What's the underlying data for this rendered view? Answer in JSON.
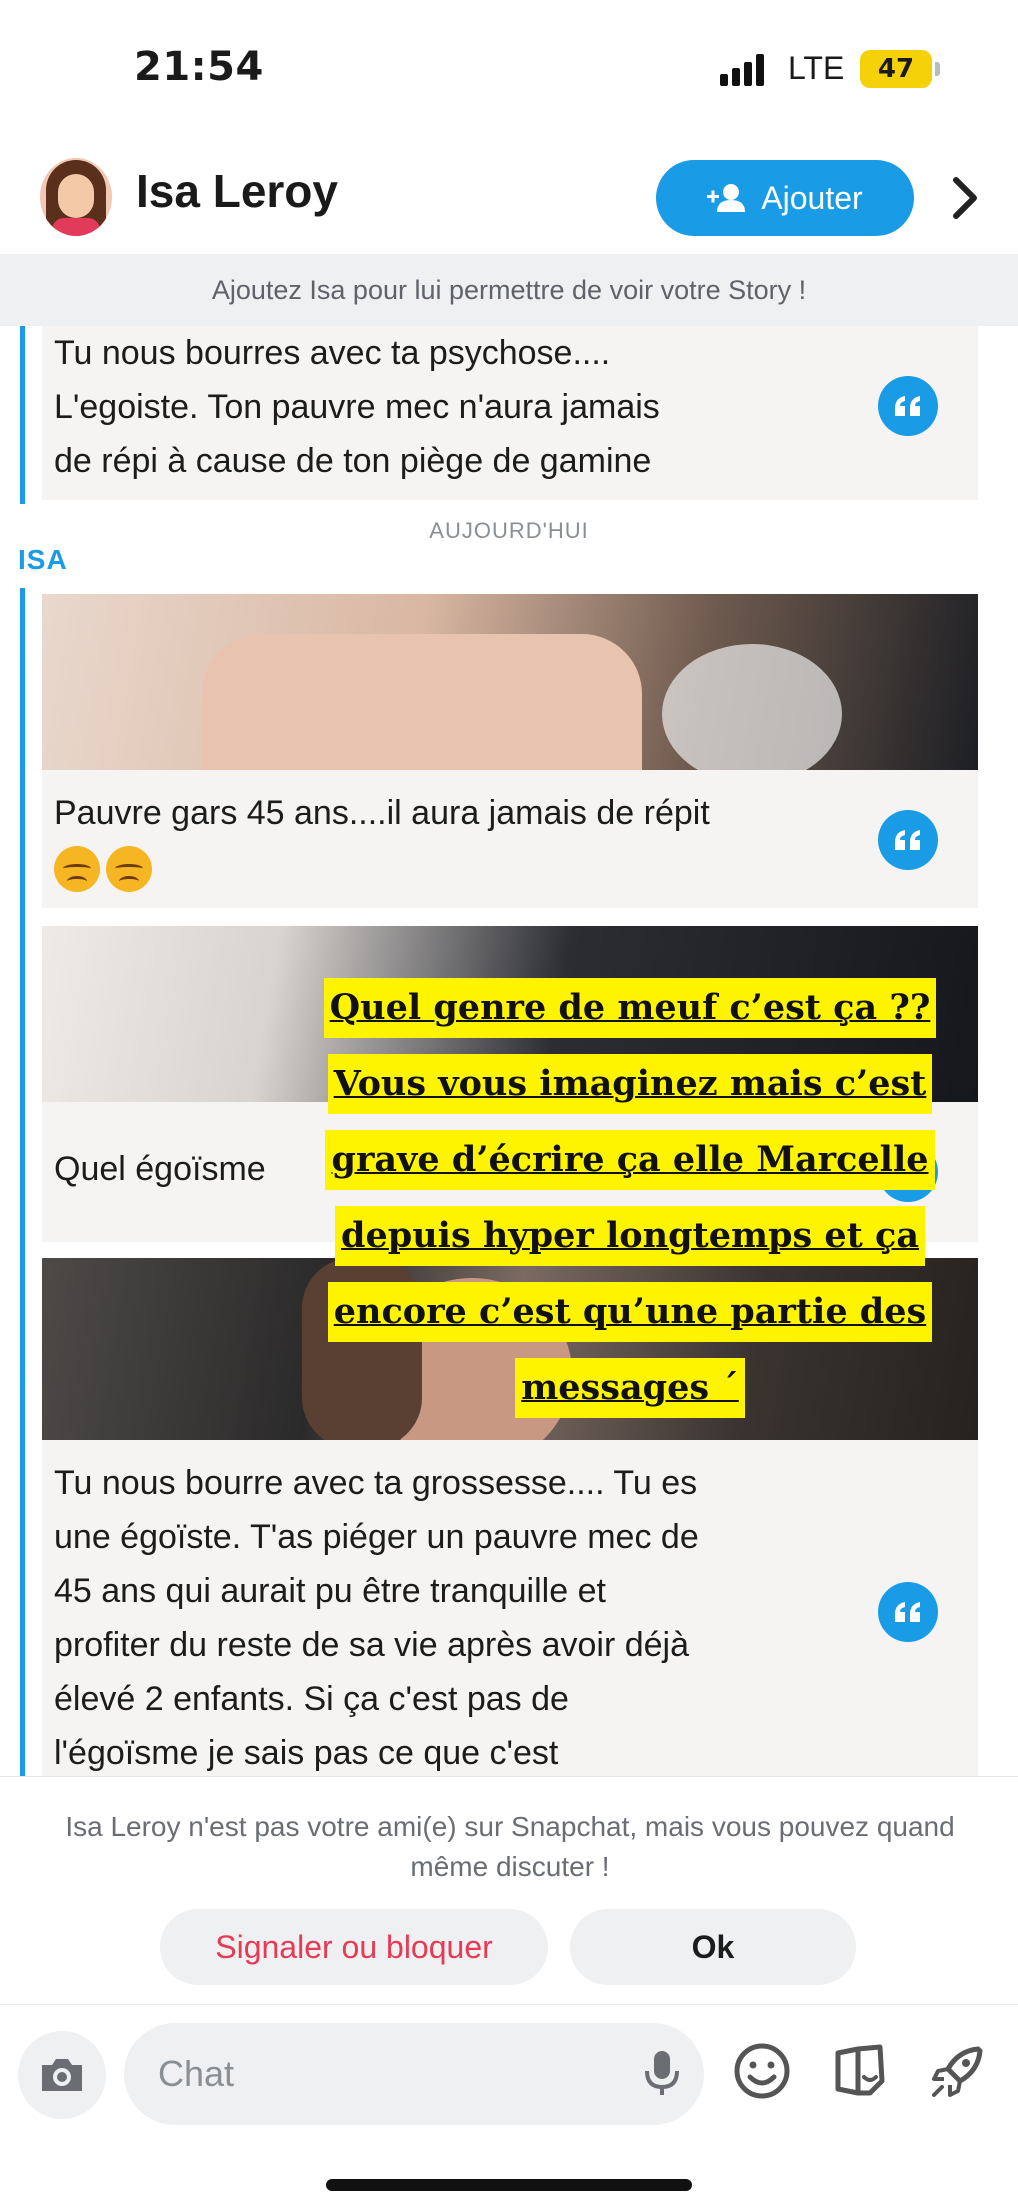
{
  "status_bar": {
    "time": "21:54",
    "network": "LTE",
    "battery": "47"
  },
  "header": {
    "title": "Isa Leroy",
    "add_label": "Ajouter"
  },
  "banner": {
    "text": "Ajoutez Isa pour lui permettre de voir votre Story !"
  },
  "chat": {
    "earlier_message": {
      "lines": [
        "Tu nous bourres avec ta psychose....",
        "L'egoiste. Ton pauvre mec  n'aura jamais",
        "de répi à cause de ton piège de gamine"
      ]
    },
    "day_label": "AUJOURD'HUI",
    "sender": "ISA",
    "messages": [
      {
        "lines": [
          "Pauvre gars 45 ans....il aura jamais de répit"
        ],
        "emoji": [
          "disappointed-face",
          "disappointed-face"
        ]
      },
      {
        "lines": [
          "Quel égoïsme"
        ]
      },
      {
        "lines": [
          "Tu nous bourre avec ta grossesse.... Tu es",
          "une égoïste. T'as piéger un pauvre mec de",
          "45 ans qui aurait pu être tranquille et",
          "profiter du reste de sa vie après avoir déjà",
          "élevé 2 enfants. Si ça c'est pas de",
          "l'égoïsme je sais pas ce que c'est"
        ]
      }
    ]
  },
  "overlay_caption": {
    "lines": [
      "Quel genre de meuf c’est ça ??",
      "Vous vous imaginez mais c’est",
      "grave d’écrire ça elle Marcelle",
      "depuis hyper longtemps et ça",
      "encore c’est qu’une partie des",
      "messages ´"
    ]
  },
  "notice": {
    "text": "Isa Leroy n'est pas votre ami(e) sur Snapchat, mais vous pouvez quand même discuter !"
  },
  "actions": {
    "report_label": "Signaler ou bloquer",
    "ok_label": "Ok"
  },
  "input": {
    "placeholder": "Chat"
  },
  "icons": [
    "camera-icon",
    "microphone-icon",
    "emoji-icon",
    "sticker-icon",
    "rocket-icon"
  ],
  "colors": {
    "accent": "#1a9be6",
    "report": "#e63a55",
    "overlay": "#fff400"
  }
}
